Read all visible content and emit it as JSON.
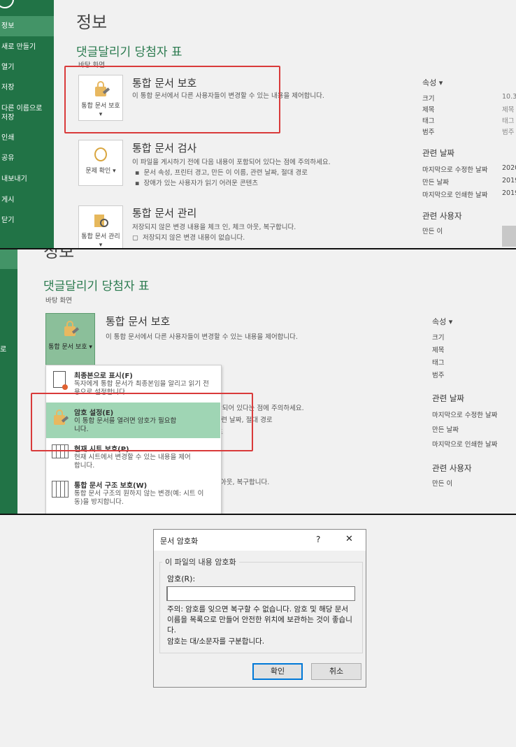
{
  "sidebar": {
    "items": [
      "정보",
      "새로 만들기",
      "열기",
      "저장",
      "다른 이름으로 저장",
      "인쇄",
      "공유",
      "내보내기",
      "게시",
      "닫기"
    ],
    "partial": "로"
  },
  "main": {
    "heading": "정보",
    "doc_title": "댓글달리기 당첨자 표",
    "location": "바탕 화면",
    "sections": [
      {
        "title": "통합 문서 보호",
        "button": "통합 문서 보호",
        "desc": "이 통합 문서에서 다른 사용자들이 변경할 수 있는 내용을 제어합니다."
      },
      {
        "title": "통합 문서 검사",
        "button": "문제 확인",
        "desc": "이 파일을 게시하기 전에 다음 내용이 포함되어 있다는 점에 주의하세요.",
        "bullets": [
          "문서 속성, 프린터 경고, 만든 이 이름, 관련 날짜, 절대 경로",
          "장애가 있는 사용자가 읽기 어려운 콘텐츠"
        ]
      },
      {
        "title": "통합 문서 관리",
        "button": "통합 문서 관리",
        "desc": "저장되지 않은 변경 내용을 체크 인, 체크 아웃, 복구합니다.",
        "note": "저장되지 않은 변경 내용이 없습니다."
      }
    ]
  },
  "properties": {
    "title": "속성",
    "rows": [
      {
        "label": "크기",
        "value": "10.3"
      },
      {
        "label": "제목",
        "value": "제목"
      },
      {
        "label": "태그",
        "value": "태그"
      },
      {
        "label": "범주",
        "value": "범주"
      }
    ],
    "dates_title": "관련 날짜",
    "dates": [
      {
        "label": "마지막으로 수정한 날짜",
        "value": "2020"
      },
      {
        "label": "만든 날짜",
        "value": "2019"
      },
      {
        "label": "마지막으로 인쇄한 날짜",
        "value": "2019"
      }
    ],
    "people_title": "관련 사용자",
    "author_label": "만든 이"
  },
  "protect_menu": [
    {
      "title": "최종본으로 표시(F)",
      "desc": "독자에게 통합 문서가 최종본임을 알리고 읽기 전용으로 설정합니다."
    },
    {
      "title": "암호 설정(E)",
      "desc": "이 통합 문서를 열려면 암호가 필요합니다."
    },
    {
      "title": "현재 시트 보호(P)",
      "desc": "현재 시트에서 변경할 수 있는 내용을 제어합니다."
    },
    {
      "title": "통합 문서 구조 보호(W)",
      "desc": "통합 문서 구조의 원하지 않는 변경(예: 시트 이동)을 방지합니다."
    }
  ],
  "dialog": {
    "title": "문서 암호화",
    "help": "?",
    "close": "✕",
    "group": "이 파일의 내용 암호화",
    "label": "암호(R):",
    "value": "",
    "warning": "주의: 암호를 잊으면 복구할 수 없습니다. 암호 및 해당 문서 이름을 목록으로 만들어 안전한 위치에 보관하는 것이 좋습니다.",
    "case_note": "암호는 대/소문자를 구분합니다.",
    "ok": "확인",
    "cancel": "취소"
  }
}
